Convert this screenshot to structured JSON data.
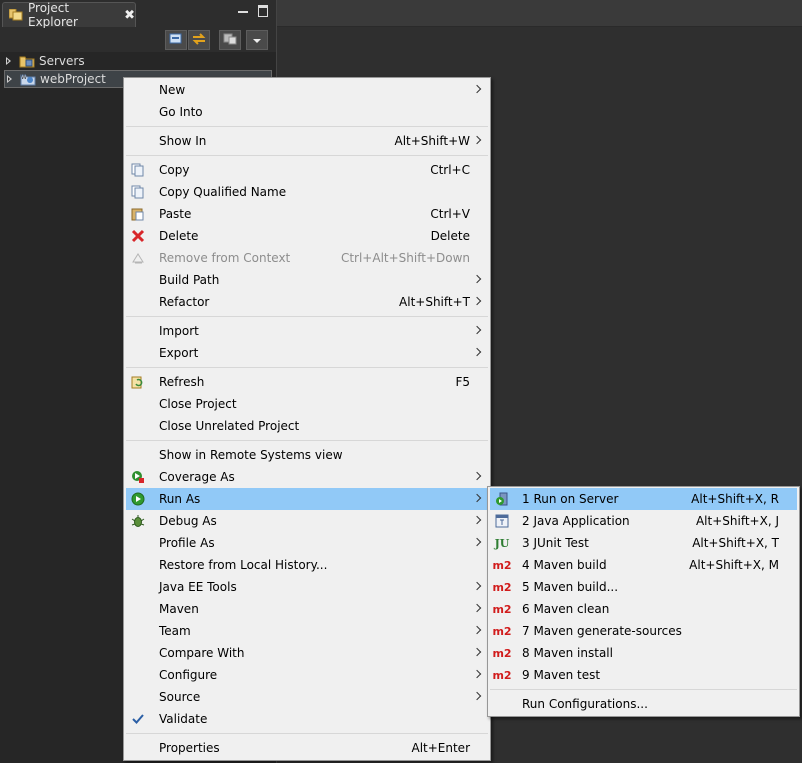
{
  "view": {
    "tab_label": "Project Explorer",
    "tab_close": "✖"
  },
  "tree": [
    {
      "label": "Servers",
      "icon": "folder-server-icon"
    },
    {
      "label": "webProject",
      "icon": "web-project-icon",
      "selected": true
    }
  ],
  "menu": {
    "items": [
      {
        "label": "New",
        "accel": "",
        "submenu": true
      },
      {
        "label": "Go Into",
        "accel": ""
      },
      {
        "label": "Show In",
        "accel": "Alt+Shift+W",
        "submenu": true
      },
      {
        "label": "Copy",
        "accel": "Ctrl+C",
        "icon": "copy-icon"
      },
      {
        "label": "Copy Qualified Name",
        "accel": "",
        "icon": "copy-qualified-icon"
      },
      {
        "label": "Paste",
        "accel": "Ctrl+V",
        "icon": "paste-icon"
      },
      {
        "label": "Delete",
        "accel": "Delete",
        "icon": "delete-icon"
      },
      {
        "label": "Remove from Context",
        "accel": "Ctrl+Alt+Shift+Down",
        "icon": "remove-context-icon",
        "disabled": true
      },
      {
        "label": "Build Path",
        "accel": "",
        "submenu": true
      },
      {
        "label": "Refactor",
        "accel": "Alt+Shift+T",
        "submenu": true
      },
      {
        "label": "Import",
        "accel": "",
        "submenu": true
      },
      {
        "label": "Export",
        "accel": "",
        "submenu": true
      },
      {
        "label": "Refresh",
        "accel": "F5",
        "icon": "refresh-icon"
      },
      {
        "label": "Close Project",
        "accel": ""
      },
      {
        "label": "Close Unrelated Project",
        "accel": ""
      },
      {
        "label": "Show in Remote Systems view",
        "accel": ""
      },
      {
        "label": "Coverage As",
        "accel": "",
        "submenu": true,
        "icon": "coverage-icon"
      },
      {
        "label": "Run As",
        "accel": "",
        "submenu": true,
        "icon": "run-icon",
        "highlighted": true
      },
      {
        "label": "Debug As",
        "accel": "",
        "submenu": true,
        "icon": "debug-icon"
      },
      {
        "label": "Profile As",
        "accel": "",
        "submenu": true
      },
      {
        "label": "Restore from Local History...",
        "accel": ""
      },
      {
        "label": "Java EE Tools",
        "accel": "",
        "submenu": true
      },
      {
        "label": "Maven",
        "accel": "",
        "submenu": true
      },
      {
        "label": "Team",
        "accel": "",
        "submenu": true
      },
      {
        "label": "Compare With",
        "accel": "",
        "submenu": true
      },
      {
        "label": "Configure",
        "accel": "",
        "submenu": true
      },
      {
        "label": "Source",
        "accel": "",
        "submenu": true
      },
      {
        "label": "Validate",
        "accel": "",
        "icon": "check-icon"
      },
      {
        "label": "Properties",
        "accel": "Alt+Enter"
      }
    ]
  },
  "submenu": {
    "items": [
      {
        "label": "1 Run on Server",
        "accel": "Alt+Shift+X, R",
        "icon": "run-on-server-icon",
        "highlighted": true
      },
      {
        "label": "2 Java Application",
        "accel": "Alt+Shift+X, J",
        "icon": "java-app-icon"
      },
      {
        "label": "3 JUnit Test",
        "accel": "Alt+Shift+X, T",
        "icon": "junit-icon"
      },
      {
        "label": "4 Maven build",
        "accel": "Alt+Shift+X, M",
        "icon": "maven-m2-icon"
      },
      {
        "label": "5 Maven build...",
        "accel": "",
        "icon": "maven-m2-icon"
      },
      {
        "label": "6 Maven clean",
        "accel": "",
        "icon": "maven-m2-icon"
      },
      {
        "label": "7 Maven generate-sources",
        "accel": "",
        "icon": "maven-m2-icon"
      },
      {
        "label": "8 Maven install",
        "accel": "",
        "icon": "maven-m2-icon"
      },
      {
        "label": "9 Maven test",
        "accel": "",
        "icon": "maven-m2-icon"
      },
      {
        "label": "Run Configurations...",
        "accel": ""
      }
    ],
    "m2_text": "m2",
    "junit_text": "JU"
  },
  "colors": {
    "highlight": "#91c9f7",
    "menu_bg": "#f0f0f0",
    "view_bg": "#262626",
    "m2_red": "#d11c1c"
  }
}
